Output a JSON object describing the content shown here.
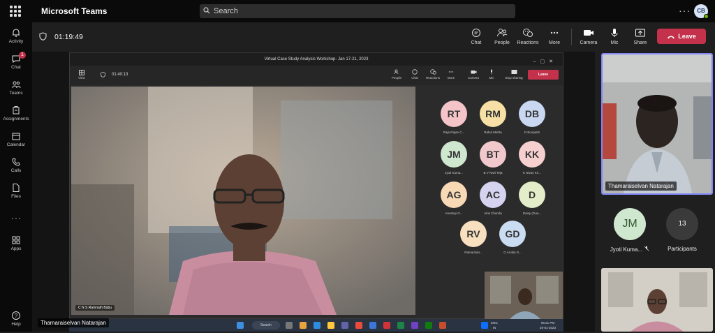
{
  "app": {
    "name": "Microsoft Teams",
    "search_placeholder": "Search",
    "user_initials": "CB"
  },
  "rail": [
    {
      "label": "Activity",
      "icon": "bell-icon"
    },
    {
      "label": "Chat",
      "icon": "chat-icon",
      "badge": "1"
    },
    {
      "label": "Teams",
      "icon": "teams-icon"
    },
    {
      "label": "Assignments",
      "icon": "assignments-icon"
    },
    {
      "label": "Calendar",
      "icon": "calendar-icon"
    },
    {
      "label": "Calls",
      "icon": "phone-icon"
    },
    {
      "label": "Files",
      "icon": "file-icon"
    },
    {
      "label": "Apps",
      "icon": "apps-icon"
    },
    {
      "label": "Help",
      "icon": "help-icon"
    }
  ],
  "meeting": {
    "timer": "01:19:49",
    "toolbar": {
      "chat": "Chat",
      "people": "People",
      "reactions": "Reactions",
      "more": "More",
      "camera": "Camera",
      "mic": "Mic",
      "share": "Share",
      "leave": "Leave"
    }
  },
  "shared_screen": {
    "window_title": "Virtual Case Study Analysis Workshop- Jan 17-21, 2023",
    "timer": "01:40:13",
    "view_label": "View",
    "toolbar": [
      "People",
      "Chat",
      "Reactions",
      "More",
      "Camera",
      "Mic",
      "Stop sharing"
    ],
    "leave": "Leave",
    "presenter_name": "C N S Ramnath Babu",
    "participants": [
      {
        "initials": "RT",
        "name": "Raja Rajan C...",
        "color": "#f4c4c8"
      },
      {
        "initials": "RM",
        "name": "Rahul Mehta",
        "color": "#f6e0a6"
      },
      {
        "initials": "DB",
        "name": "D Boopathi",
        "color": "#c9d8f0"
      },
      {
        "initials": "JM",
        "name": "Jyoti Kuma...",
        "color": "#cfe6cf"
      },
      {
        "initials": "BT",
        "name": "B V Ravi Teja",
        "color": "#f1c9cd"
      },
      {
        "initials": "KK",
        "name": "K Nivas Kri...",
        "color": "#f6cfcf"
      },
      {
        "initials": "AG",
        "name": "Anustup G...",
        "color": "#f8d9b6"
      },
      {
        "initials": "AC",
        "name": "Alok Chanda",
        "color": "#d6d3f0"
      },
      {
        "initials": "D",
        "name": "Daisy (Gue...",
        "color": "#e3edc9"
      },
      {
        "initials": "RV",
        "name": "Ramachan...",
        "color": "#f8dfbf"
      },
      {
        "initials": "GD",
        "name": "G Arokia D...",
        "color": "#c9dcf2"
      }
    ],
    "taskbar": {
      "search": "Search",
      "lang_1": "ENG",
      "lang_2": "IN",
      "time": "06:21 PM",
      "date": "20-01-2023"
    }
  },
  "bottom_name": "Thamaraiselvan Natarajan",
  "right_panel": {
    "spotlight_name": "Thamaraiselvan Natarajan",
    "tile_initials": "JM",
    "tile_name": "Jyoti Kuma...",
    "participants_count": "13",
    "participants_label": "Participants"
  }
}
